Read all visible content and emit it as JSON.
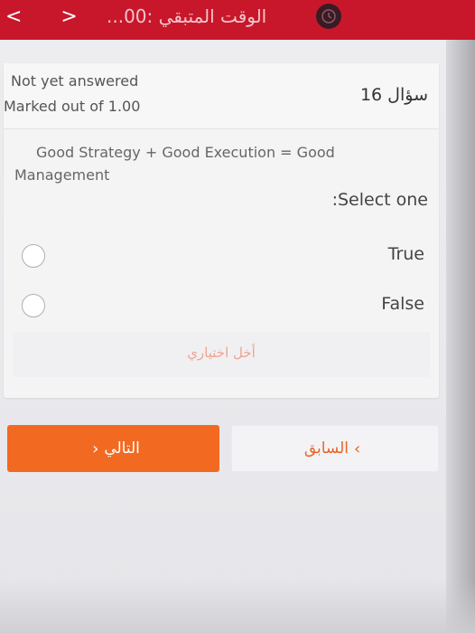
{
  "topbar": {
    "nav_left": "< >",
    "timer_text": "الوقت المتبقي :00...",
    "timer_icon": "clock-icon"
  },
  "question": {
    "status": "Not yet answered",
    "marks": "Marked out of 1.00",
    "number_label": "سؤال 16",
    "text_line1": "Good Strategy + Good Execution = Good",
    "text_line2": "Management",
    "prompt": ":Select one",
    "options": [
      {
        "label": "True",
        "selected": false
      },
      {
        "label": "False",
        "selected": false
      }
    ],
    "clear_choice": "أخل اختياري"
  },
  "navigation": {
    "next_label": "التالي",
    "prev_label": "السابق",
    "next_color": "#f26a21",
    "prev_text_color": "#e8642a"
  },
  "colors": {
    "topbar": "#c8172a",
    "accent": "#f26a21"
  }
}
